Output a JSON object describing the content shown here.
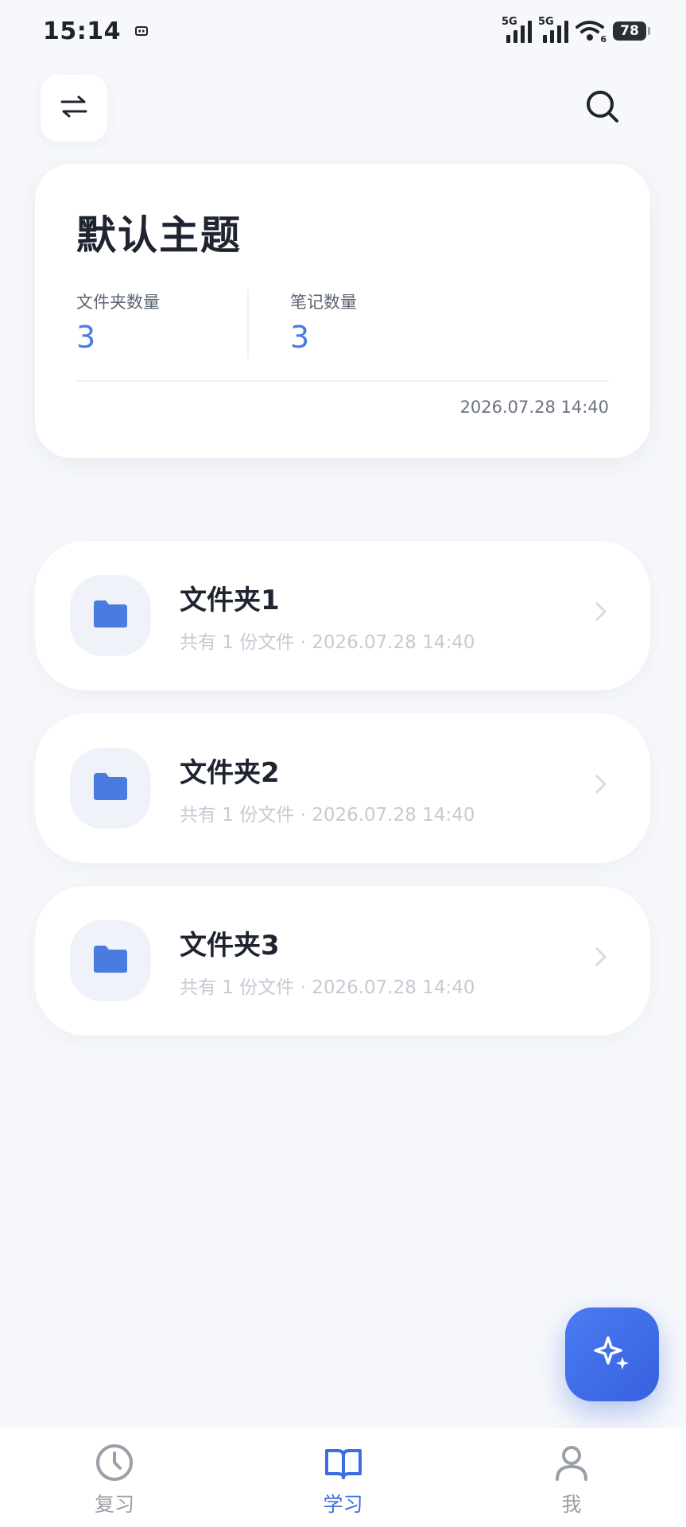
{
  "status_bar": {
    "time": "15:14",
    "network_1": "5G",
    "network_2": "5G",
    "wifi_label": "6",
    "battery": "78"
  },
  "topbar": {
    "switch_icon": "swap-arrows-icon",
    "search_icon": "search-icon"
  },
  "topic": {
    "title": "默认主题",
    "folder_count_label": "文件夹数量",
    "folder_count": "3",
    "note_count_label": "笔记数量",
    "note_count": "3",
    "updated": "2026.07.28 14:40"
  },
  "folders": [
    {
      "name": "文件夹1",
      "meta": "共有 1 份文件 · 2026.07.28 14:40"
    },
    {
      "name": "文件夹2",
      "meta": "共有 1 份文件 · 2026.07.28 14:40"
    },
    {
      "name": "文件夹3",
      "meta": "共有 1 份文件 · 2026.07.28 14:40"
    }
  ],
  "fab": {
    "icon": "sparkle-icon"
  },
  "nav": {
    "review": "复习",
    "study": "学习",
    "me": "我",
    "active": "study"
  },
  "colors": {
    "accent": "#3d6ee0",
    "folder_icon": "#4a7be0",
    "background": "#f6f8fb"
  }
}
